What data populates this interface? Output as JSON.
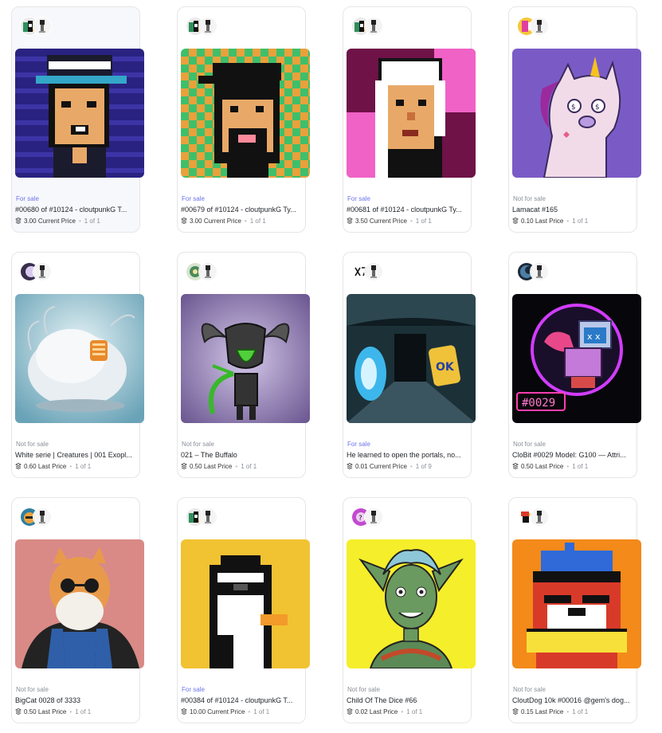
{
  "cards": [
    {
      "status": "For sale",
      "title": "#00680 of #10124 - cloutpunkG T...",
      "price": "3.00",
      "price_label": "Current Price",
      "editions": "1 of 1"
    },
    {
      "status": "For sale",
      "title": "#00679 of #10124 - cloutpunkG Ty...",
      "price": "3.00",
      "price_label": "Current Price",
      "editions": "1 of 1"
    },
    {
      "status": "For sale",
      "title": "#00681 of #10124 - cloutpunkG Ty...",
      "price": "3.50",
      "price_label": "Current Price",
      "editions": "1 of 1"
    },
    {
      "status": "Not for sale",
      "title": "Lamacat #165",
      "price": "0.10",
      "price_label": "Last Price",
      "editions": "1 of 1"
    },
    {
      "status": "Not for sale",
      "title": "White serie | Creatures | 001 Exopl...",
      "price": "0.60",
      "price_label": "Last Price",
      "editions": "1 of 1"
    },
    {
      "status": "Not for sale",
      "title": "021 – The Buffalo",
      "price": "0.50",
      "price_label": "Last Price",
      "editions": "1 of 1"
    },
    {
      "status": "For sale",
      "title": "He learned to open the portals, no...",
      "price": "0.01",
      "price_label": "Current Price",
      "editions": "1 of 9"
    },
    {
      "status": "Not for sale",
      "title": "CloBit #0029 Model: G100 — Attri...",
      "price": "0.50",
      "price_label": "Last Price",
      "editions": "1 of 1"
    },
    {
      "status": "Not for sale",
      "title": "BigCat 0028 of 3333",
      "price": "0.50",
      "price_label": "Last Price",
      "editions": "1 of 1"
    },
    {
      "status": "For sale",
      "title": "#00384 of #10124 - cloutpunkG T...",
      "price": "10.00",
      "price_label": "Current Price",
      "editions": "1 of 1"
    },
    {
      "status": "Not for sale",
      "title": "Child Of The Dice #66",
      "price": "0.02",
      "price_label": "Last Price",
      "editions": "1 of 1"
    },
    {
      "status": "Not for sale",
      "title": "CloutDog 10k #00016 @gem's dog...",
      "price": "0.15",
      "price_label": "Last Price",
      "editions": "1 of 1"
    }
  ],
  "art_text": {
    "clobit_tag": "#0029"
  },
  "colors": {
    "for_sale": "#6b73f0",
    "not_for_sale": "#8a8f98",
    "border": "#e6e6e6"
  }
}
